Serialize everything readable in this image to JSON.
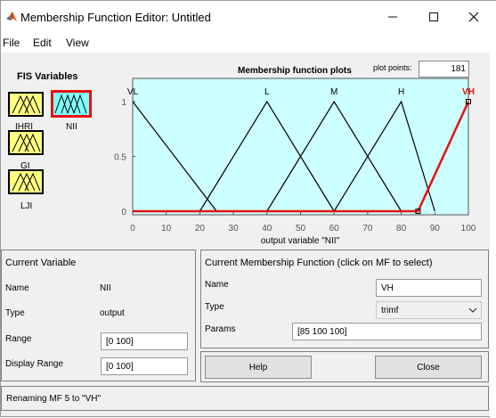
{
  "window": {
    "title": "Membership Function Editor: Untitled"
  },
  "menubar": {
    "file": "File",
    "edit": "Edit",
    "view": "View"
  },
  "fis_variables": {
    "heading": "FIS Variables",
    "inputs": [
      {
        "name": "IHRI"
      },
      {
        "name": "GI"
      },
      {
        "name": "LJI"
      }
    ],
    "output": {
      "name": "NII",
      "selected": true
    }
  },
  "plot": {
    "title": "Membership function plots",
    "plot_points_label": "plot points:",
    "plot_points": "181",
    "background": "#ccffff",
    "selected_color": "#e81010",
    "xlabel": "output variable \"NII\"",
    "x_ticks": [
      "0",
      "10",
      "20",
      "30",
      "40",
      "50",
      "60",
      "70",
      "80",
      "90",
      "100"
    ],
    "y_ticks": [
      "0",
      "0.5",
      "1"
    ]
  },
  "chart_data": {
    "type": "line",
    "xlim": [
      0,
      100
    ],
    "ylim": [
      0,
      1
    ],
    "xlabel": "output variable \"NII\"",
    "series": [
      {
        "name": "VL",
        "points": [
          [
            0,
            1
          ],
          [
            25,
            0
          ]
        ],
        "selected": false
      },
      {
        "name": "L",
        "points": [
          [
            20,
            0
          ],
          [
            40,
            1
          ],
          [
            60,
            0
          ]
        ],
        "selected": false
      },
      {
        "name": "M",
        "points": [
          [
            40,
            0
          ],
          [
            60,
            1
          ],
          [
            80,
            0
          ]
        ],
        "selected": false
      },
      {
        "name": "H",
        "points": [
          [
            60,
            0
          ],
          [
            80,
            1
          ],
          [
            90,
            0
          ]
        ],
        "selected": false
      },
      {
        "name": "VH",
        "points": [
          [
            0,
            0
          ],
          [
            85,
            0
          ],
          [
            100,
            1
          ]
        ],
        "selected": true
      }
    ]
  },
  "current_variable": {
    "heading": "Current Variable",
    "name_label": "Name",
    "name_value": "NII",
    "type_label": "Type",
    "type_value": "output",
    "range_label": "Range",
    "range_value": "[0 100]",
    "display_range_label": "Display Range",
    "display_range_value": "[0 100]"
  },
  "current_mf": {
    "heading": "Current Membership Function (click on MF to select)",
    "name_label": "Name",
    "name_value": "VH",
    "type_label": "Type",
    "type_value": "trimf",
    "params_label": "Params",
    "params_value": "[85 100 100]"
  },
  "buttons": {
    "help": "Help",
    "close": "Close"
  },
  "status": {
    "text": "Renaming MF 5 to \"VH\""
  }
}
